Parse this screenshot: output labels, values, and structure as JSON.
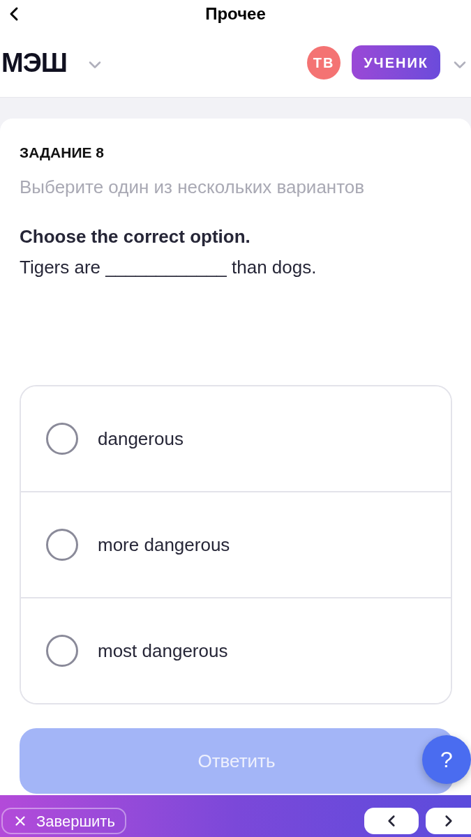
{
  "top_bar": {
    "title": "Прочее"
  },
  "header": {
    "logo": "МЭШ",
    "avatar_initials": "ТВ",
    "role": "УЧЕНИК"
  },
  "task": {
    "label": "ЗАДАНИЕ 8",
    "instruction": "Выберите один из нескольких вариантов",
    "prompt": "Choose the correct option.",
    "sentence": "Tigers are ____________ than dogs."
  },
  "options": [
    {
      "label": "dangerous",
      "selected": false
    },
    {
      "label": "more dangerous",
      "selected": false
    },
    {
      "label": "most dangerous",
      "selected": false
    }
  ],
  "answer_button": {
    "label": "Ответить",
    "disabled": true
  },
  "help_button": {
    "label": "?"
  },
  "bottom_bar": {
    "finish_label": "Завершить"
  }
}
